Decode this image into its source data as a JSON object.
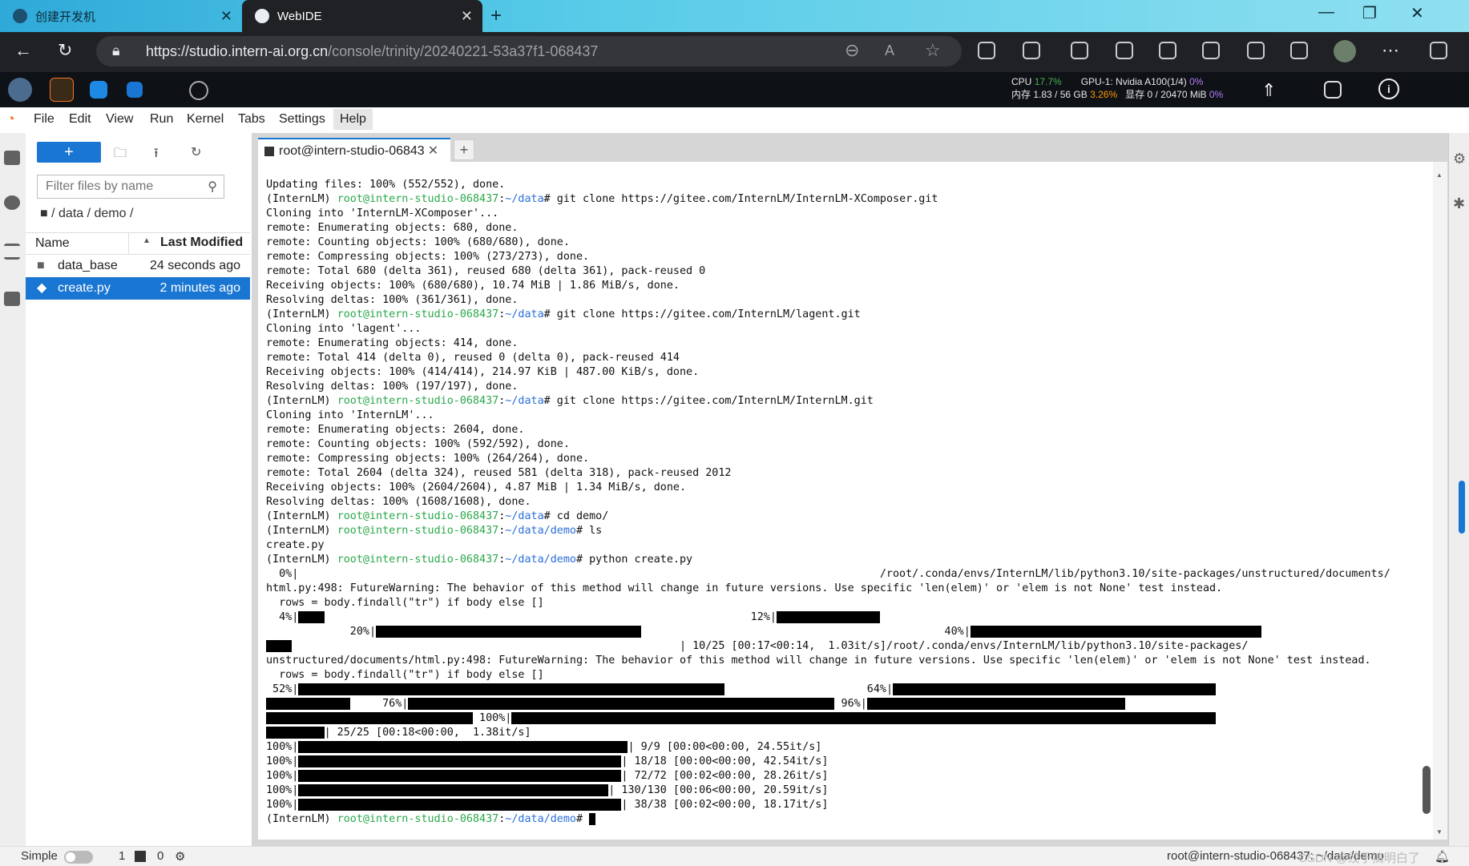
{
  "browser": {
    "tabs": [
      {
        "title": "创建开发机",
        "active": false
      },
      {
        "title": "WebIDE",
        "active": true
      }
    ],
    "url_domain": "https://studio.intern-ai.org.cn",
    "url_path": "/console/trinity/20240221-53a37f1-068437"
  },
  "stats": {
    "cpu_label": "CPU",
    "cpu_value": "17.7%",
    "mem_label": "内存",
    "mem_value": "1.83 / 56 GB",
    "mem_pct": "3.26%",
    "gpu_label": "GPU-1: Nvidia A100(1/4)",
    "gpu_pct": "0%",
    "vram_label": "显存",
    "vram_value": "0 / 20470 MiB",
    "vram_pct": "0%"
  },
  "menu": [
    "File",
    "Edit",
    "View",
    "Run",
    "Kernel",
    "Tabs",
    "Settings",
    "Help"
  ],
  "filebrowser": {
    "new_label": "+",
    "filter_placeholder": "Filter files by name",
    "breadcrumb": "/ data / demo /",
    "col_name": "Name",
    "col_modified": "Last Modified",
    "files": [
      {
        "name": "data_base",
        "modified": "24 seconds ago",
        "type": "folder",
        "selected": false
      },
      {
        "name": "create.py",
        "modified": "2 minutes ago",
        "type": "python",
        "selected": true
      }
    ]
  },
  "terminal": {
    "tab_title": "root@intern-studio-06843",
    "lines": [
      [
        {
          "t": "Updating files: 100% (552/552), done.",
          "c": "pre"
        }
      ],
      [
        {
          "t": "(InternLM) ",
          "c": "pre"
        },
        {
          "t": "root@intern-studio-068437",
          "c": "usr"
        },
        {
          "t": ":",
          "c": "pre"
        },
        {
          "t": "~/data",
          "c": "pth"
        },
        {
          "t": "# git clone https://gitee.com/InternLM/InternLM-XComposer.git",
          "c": "pre"
        }
      ],
      [
        {
          "t": "Cloning into 'InternLM-XComposer'...",
          "c": "pre"
        }
      ],
      [
        {
          "t": "remote: Enumerating objects: 680, done.",
          "c": "pre"
        }
      ],
      [
        {
          "t": "remote: Counting objects: 100% (680/680), done.",
          "c": "pre"
        }
      ],
      [
        {
          "t": "remote: Compressing objects: 100% (273/273), done.",
          "c": "pre"
        }
      ],
      [
        {
          "t": "remote: Total 680 (delta 361), reused 680 (delta 361), pack-reused 0",
          "c": "pre"
        }
      ],
      [
        {
          "t": "Receiving objects: 100% (680/680), 10.74 MiB | 1.86 MiB/s, done.",
          "c": "pre"
        }
      ],
      [
        {
          "t": "Resolving deltas: 100% (361/361), done.",
          "c": "pre"
        }
      ],
      [
        {
          "t": "(InternLM) ",
          "c": "pre"
        },
        {
          "t": "root@intern-studio-068437",
          "c": "usr"
        },
        {
          "t": ":",
          "c": "pre"
        },
        {
          "t": "~/data",
          "c": "pth"
        },
        {
          "t": "# git clone https://gitee.com/InternLM/lagent.git",
          "c": "pre"
        }
      ],
      [
        {
          "t": "Cloning into 'lagent'...",
          "c": "pre"
        }
      ],
      [
        {
          "t": "remote: Enumerating objects: 414, done.",
          "c": "pre"
        }
      ],
      [
        {
          "t": "remote: Total 414 (delta 0), reused 0 (delta 0), pack-reused 414",
          "c": "pre"
        }
      ],
      [
        {
          "t": "Receiving objects: 100% (414/414), 214.97 KiB | 487.00 KiB/s, done.",
          "c": "pre"
        }
      ],
      [
        {
          "t": "Resolving deltas: 100% (197/197), done.",
          "c": "pre"
        }
      ],
      [
        {
          "t": "(InternLM) ",
          "c": "pre"
        },
        {
          "t": "root@intern-studio-068437",
          "c": "usr"
        },
        {
          "t": ":",
          "c": "pre"
        },
        {
          "t": "~/data",
          "c": "pth"
        },
        {
          "t": "# git clone https://gitee.com/InternLM/InternLM.git",
          "c": "pre"
        }
      ],
      [
        {
          "t": "Cloning into 'InternLM'...",
          "c": "pre"
        }
      ],
      [
        {
          "t": "remote: Enumerating objects: 2604, done.",
          "c": "pre"
        }
      ],
      [
        {
          "t": "remote: Counting objects: 100% (592/592), done.",
          "c": "pre"
        }
      ],
      [
        {
          "t": "remote: Compressing objects: 100% (264/264), done.",
          "c": "pre"
        }
      ],
      [
        {
          "t": "remote: Total 2604 (delta 324), reused 581 (delta 318), pack-reused 2012",
          "c": "pre"
        }
      ],
      [
        {
          "t": "Receiving objects: 100% (2604/2604), 4.87 MiB | 1.34 MiB/s, done.",
          "c": "pre"
        }
      ],
      [
        {
          "t": "Resolving deltas: 100% (1608/1608), done.",
          "c": "pre"
        }
      ],
      [
        {
          "t": "(InternLM) ",
          "c": "pre"
        },
        {
          "t": "root@intern-studio-068437",
          "c": "usr"
        },
        {
          "t": ":",
          "c": "pre"
        },
        {
          "t": "~/data",
          "c": "pth"
        },
        {
          "t": "# cd demo/",
          "c": "pre"
        }
      ],
      [
        {
          "t": "(InternLM) ",
          "c": "pre"
        },
        {
          "t": "root@intern-studio-068437",
          "c": "usr"
        },
        {
          "t": ":",
          "c": "pre"
        },
        {
          "t": "~/data/demo",
          "c": "pth"
        },
        {
          "t": "# ls",
          "c": "pre"
        }
      ],
      [
        {
          "t": "create.py",
          "c": "pre"
        }
      ],
      [
        {
          "t": "(InternLM) ",
          "c": "pre"
        },
        {
          "t": "root@intern-studio-068437",
          "c": "usr"
        },
        {
          "t": ":",
          "c": "pre"
        },
        {
          "t": "~/data/demo",
          "c": "pth"
        },
        {
          "t": "# python create.py",
          "c": "pre"
        }
      ],
      [
        {
          "t": "  0%|                                                                                          /root/.conda/envs/InternLM/lib/python3.10/site-packages/unstructured/documents/",
          "c": "pre"
        }
      ],
      [
        {
          "t": "html.py:498: FutureWarning: The behavior of this method will change in future versions. Use specific 'len(elem)' or 'elem is not None' test instead.",
          "c": "pre"
        }
      ],
      [
        {
          "t": "  rows = body.findall(\"tr\") if body else []",
          "c": "pre"
        }
      ],
      [
        {
          "t": "  4%|",
          "c": "pre"
        },
        {
          "t": "    ",
          "c": "blk"
        },
        {
          "t": "                                                                  12%|",
          "c": "pre"
        },
        {
          "t": "                ",
          "c": "blk"
        }
      ],
      [
        {
          "t": "             20%|",
          "c": "pre"
        },
        {
          "t": "                                         ",
          "c": "blk"
        },
        {
          "t": "                                               40%|",
          "c": "pre"
        },
        {
          "t": "                                             ",
          "c": "blk"
        }
      ],
      [
        {
          "t": "    ",
          "c": "blk"
        },
        {
          "t": "                                                            | 10/25 [00:17<00:14,  1.03it/s]/root/.conda/envs/InternLM/lib/python3.10/site-packages/",
          "c": "pre"
        }
      ],
      [
        {
          "t": "unstructured/documents/html.py:498: FutureWarning: The behavior of this method will change in future versions. Use specific 'len(elem)' or 'elem is not None' test instead.",
          "c": "pre"
        }
      ],
      [
        {
          "t": "  rows = body.findall(\"tr\") if body else []",
          "c": "pre"
        }
      ],
      [
        {
          "t": " 52%|",
          "c": "pre"
        },
        {
          "t": "                                                                  ",
          "c": "blk"
        },
        {
          "t": "                      64%|",
          "c": "pre"
        },
        {
          "t": "                                                  ",
          "c": "blk"
        }
      ],
      [
        {
          "t": "             ",
          "c": "blk"
        },
        {
          "t": "     76%|",
          "c": "pre"
        },
        {
          "t": "                                                                  ",
          "c": "blk"
        },
        {
          "t": " 96%|",
          "c": "pre"
        },
        {
          "t": "                                        ",
          "c": "blk"
        }
      ],
      [
        {
          "t": "                                ",
          "c": "blk"
        },
        {
          "t": " 100%|",
          "c": "pre"
        },
        {
          "t": "                                                                                                             ",
          "c": "blk"
        }
      ],
      [
        {
          "t": "         ",
          "c": "blk"
        },
        {
          "t": "| 25/25 [00:18<00:00,  1.38it/s]",
          "c": "pre"
        }
      ],
      [
        {
          "t": "100%|",
          "c": "pre"
        },
        {
          "t": "                                                   ",
          "c": "blk"
        },
        {
          "t": "| 9/9 [00:00<00:00, 24.55it/s]",
          "c": "pre"
        }
      ],
      [
        {
          "t": "100%|",
          "c": "pre"
        },
        {
          "t": "                                                  ",
          "c": "blk"
        },
        {
          "t": "| 18/18 [00:00<00:00, 42.54it/s]",
          "c": "pre"
        }
      ],
      [
        {
          "t": "100%|",
          "c": "pre"
        },
        {
          "t": "                                                  ",
          "c": "blk"
        },
        {
          "t": "| 72/72 [00:02<00:00, 28.26it/s]",
          "c": "pre"
        }
      ],
      [
        {
          "t": "100%|",
          "c": "pre"
        },
        {
          "t": "                                                ",
          "c": "blk"
        },
        {
          "t": "| 130/130 [00:06<00:00, 20.59it/s]",
          "c": "pre"
        }
      ],
      [
        {
          "t": "100%|",
          "c": "pre"
        },
        {
          "t": "                                                  ",
          "c": "blk"
        },
        {
          "t": "| 38/38 [00:02<00:00, 18.17it/s]",
          "c": "pre"
        }
      ],
      [
        {
          "t": "(InternLM) ",
          "c": "pre"
        },
        {
          "t": "root@intern-studio-068437",
          "c": "usr"
        },
        {
          "t": ":",
          "c": "pre"
        },
        {
          "t": "~/data/demo",
          "c": "pth"
        },
        {
          "t": "# ",
          "c": "pre"
        },
        {
          "t": " ",
          "c": "blk"
        }
      ]
    ]
  },
  "statusbar": {
    "mode_label": "Simple",
    "terminals_count": "1",
    "kernels_count": "0",
    "right_text": "root@intern-studio-068437: ~/data/demo",
    "watermark": "CSDN @绞于搞明白了"
  },
  "colors": {
    "accent": "#1976d2",
    "prompt_user": "#2aa84a",
    "prompt_path": "#2b6fd8"
  },
  "icons": {
    "back": "arrow-left-icon",
    "reload": "refresh-icon",
    "lock": "lock-icon",
    "zoom": "zoom-icon",
    "star": "star-icon",
    "folder": "folder-icon",
    "python": "python-file-icon"
  }
}
